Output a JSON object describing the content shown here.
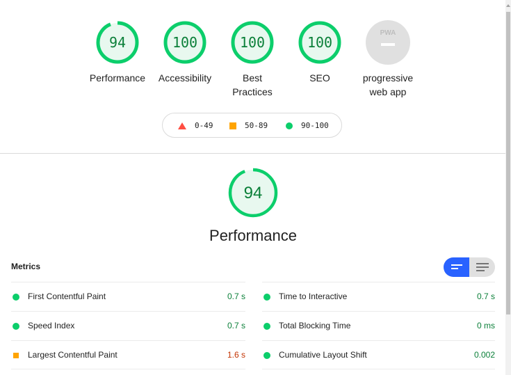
{
  "categories": [
    {
      "id": "performance",
      "label": "Performance",
      "score": 94,
      "max": 100,
      "type": "score"
    },
    {
      "id": "accessibility",
      "label": "Accessibility",
      "score": 100,
      "max": 100,
      "type": "score"
    },
    {
      "id": "best-practices",
      "label": "Best Practices",
      "score": 100,
      "max": 100,
      "type": "score"
    },
    {
      "id": "seo",
      "label": "SEO",
      "score": 100,
      "max": 100,
      "type": "score"
    },
    {
      "id": "pwa",
      "label": "progressive web app",
      "badge": "PWA",
      "type": "pwa"
    }
  ],
  "legend": {
    "fail": "0-49",
    "average": "50-89",
    "pass": "90-100"
  },
  "performance_section": {
    "score": 94,
    "max": 100,
    "title": "Performance"
  },
  "metrics": {
    "title": "Metrics",
    "view_toggle": {
      "compact_active": true
    },
    "left": [
      {
        "name": "First Contentful Paint",
        "value": "0.7 s",
        "rating": "pass"
      },
      {
        "name": "Speed Index",
        "value": "0.7 s",
        "rating": "pass"
      },
      {
        "name": "Largest Contentful Paint",
        "value": "1.6 s",
        "rating": "average"
      }
    ],
    "right": [
      {
        "name": "Time to Interactive",
        "value": "0.7 s",
        "rating": "pass"
      },
      {
        "name": "Total Blocking Time",
        "value": "0 ms",
        "rating": "pass"
      },
      {
        "name": "Cumulative Layout Shift",
        "value": "0.002",
        "rating": "pass"
      }
    ]
  },
  "colors": {
    "pass": "#0cce6b",
    "pass_text": "#0a7f38",
    "pass_bg": "#e8f8ef",
    "average": "#ffa400",
    "average_text": "#c33300",
    "fail": "#ff4e42",
    "accent": "#2962ff",
    "pwa_bg": "#e0e0e0"
  },
  "scroll": {
    "position_fraction": 0.0
  }
}
